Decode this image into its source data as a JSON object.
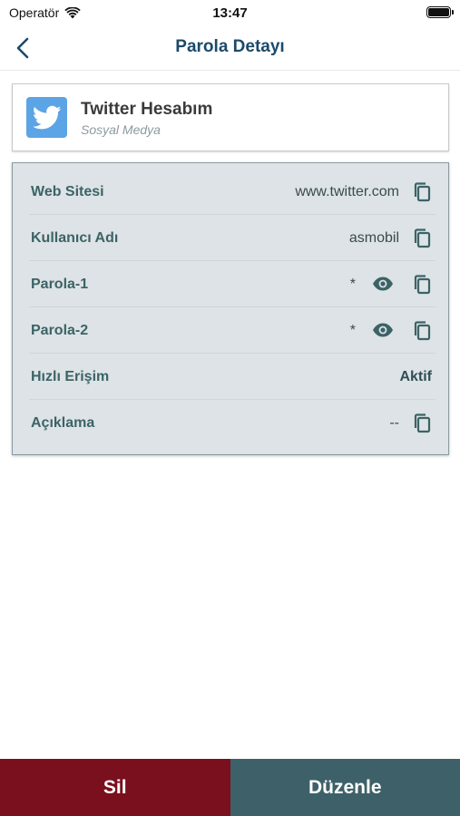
{
  "status_bar": {
    "carrier": "Operatör",
    "time": "13:47"
  },
  "nav": {
    "title": "Parola Detayı"
  },
  "account": {
    "name": "Twitter Hesabım",
    "category": "Sosyal Medya",
    "logo": "twitter-bird-icon"
  },
  "details": {
    "website": {
      "label": "Web Sitesi",
      "value": "www.twitter.com"
    },
    "username": {
      "label": "Kullanıcı Adı",
      "value": "asmobil"
    },
    "password1": {
      "label": "Parola-1",
      "value": "*"
    },
    "password2": {
      "label": "Parola-2",
      "value": "*"
    },
    "quick_access": {
      "label": "Hızlı Erişim",
      "value": "Aktif"
    },
    "description": {
      "label": "Açıklama",
      "value": "--"
    }
  },
  "actions": {
    "delete_label": "Sil",
    "edit_label": "Düzenle"
  },
  "colors": {
    "delete": "#7a0f1d",
    "edit": "#3e6068",
    "title": "#1b4a6b",
    "label": "#3c6366",
    "card_bg": "#dde3e6"
  }
}
